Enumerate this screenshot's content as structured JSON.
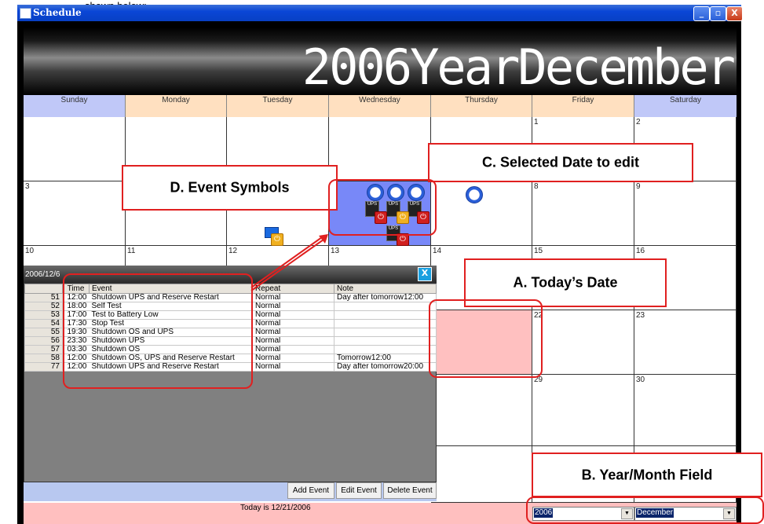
{
  "caption_top": "shown below:",
  "window": {
    "title": "Schedule",
    "min": "_",
    "max": "▫",
    "close": "X"
  },
  "banner": "2006YearDecember",
  "days": [
    "Sunday",
    "Monday",
    "Tuesday",
    "Wednesday",
    "Thursday",
    "Friday",
    "Saturday"
  ],
  "dates": {
    "r1": [
      "",
      "",
      "",
      "",
      "",
      "1",
      "2"
    ],
    "r2": [
      "3",
      "",
      "",
      "",
      "",
      "8",
      "9"
    ],
    "r3": [
      "10",
      "11",
      "12",
      "13",
      "14",
      "15",
      "16"
    ],
    "r4": [
      "",
      "",
      "",
      "",
      "",
      "22",
      "23"
    ],
    "r5": [
      "",
      "",
      "",
      "",
      "",
      "29",
      "30"
    ]
  },
  "popup": {
    "title": "2006/12/6",
    "close": "X",
    "columns": [
      "Time",
      "Event",
      "Repeat",
      "Note"
    ],
    "rows": [
      {
        "idx": "51",
        "time": "12:00",
        "event": "Shutdown UPS and Reserve Restart",
        "repeat": "Normal",
        "note": "Day after tomorrow12:00"
      },
      {
        "idx": "52",
        "time": "18:00",
        "event": "Self Test",
        "repeat": "Normal",
        "note": ""
      },
      {
        "idx": "53",
        "time": "17:00",
        "event": "Test to Battery Low",
        "repeat": "Normal",
        "note": ""
      },
      {
        "idx": "54",
        "time": "17:30",
        "event": "Stop Test",
        "repeat": "Normal",
        "note": ""
      },
      {
        "idx": "55",
        "time": "19:30",
        "event": "Shutdown OS and UPS",
        "repeat": "Normal",
        "note": ""
      },
      {
        "idx": "56",
        "time": "23:30",
        "event": "Shutdown UPS",
        "repeat": "Normal",
        "note": ""
      },
      {
        "idx": "57",
        "time": "03:30",
        "event": "Shutdown OS",
        "repeat": "Normal",
        "note": ""
      },
      {
        "idx": "58",
        "time": "12:00",
        "event": "Shutdown OS, UPS and Reserve Restart",
        "repeat": "Normal",
        "note": "Tomorrow12:00"
      },
      {
        "idx": "77",
        "time": "12:00",
        "event": "Shutdown UPS and Reserve Restart",
        "repeat": "Normal",
        "note": "Day after tomorrow20:00"
      }
    ],
    "buttons": {
      "add": "Add Event",
      "edit": "Edit Event",
      "delete": "Delete Event"
    }
  },
  "today": "Today is  12/21/2006",
  "year_select": "2006",
  "month_select": "December",
  "annotations": {
    "a": "A. Today’s Date",
    "b": "B. Year/Month Field",
    "c": "C. Selected Date to edit",
    "d": "D. Event Symbols"
  },
  "icons": {
    "ups_label": "UPS",
    "power": "⏻"
  },
  "colors": {
    "weekend_header": "#c0c8f8",
    "weekday_header": "#ffe0c0",
    "selected_date": "#7888f8",
    "today_cell": "#ffc0c0",
    "annotation": "#e02020"
  }
}
